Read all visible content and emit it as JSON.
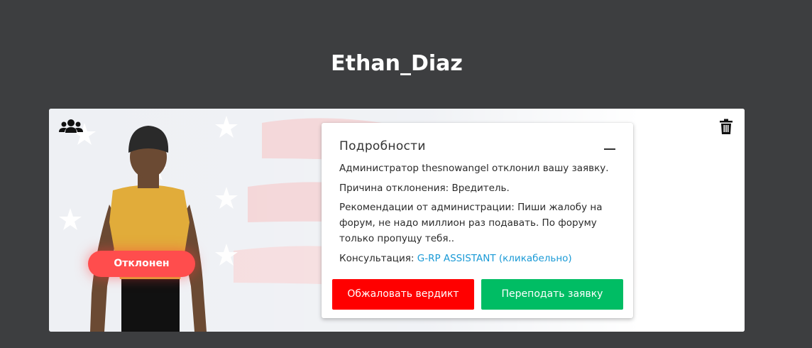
{
  "page": {
    "title": "Ethan_Diaz"
  },
  "card": {
    "status_label": "Отклонен",
    "icons": {
      "group": "users-group-icon",
      "trash": "trash-icon"
    },
    "details": {
      "title": "Подробности",
      "line1": "Администратор thesnowangel отклонил вашу заявку.",
      "line2": "Причина отклонения: Вредитель.",
      "recommendation": "Рекомендации от администрации: Пиши жалобу на форум, не надо миллион раз подавать. По форуму только пропущу тебя..",
      "consult_prefix": "Консультация: ",
      "consult_link": "G-RP ASSISTANT (кликабельно)",
      "appeal_label": "Обжаловать вердикт",
      "resubmit_label": "Переподать заявку"
    }
  },
  "colors": {
    "background": "#3d3e40",
    "status": "#ff4d4d",
    "appeal": "#ff0000",
    "resubmit": "#00bd64",
    "link": "#1a9ad6"
  }
}
